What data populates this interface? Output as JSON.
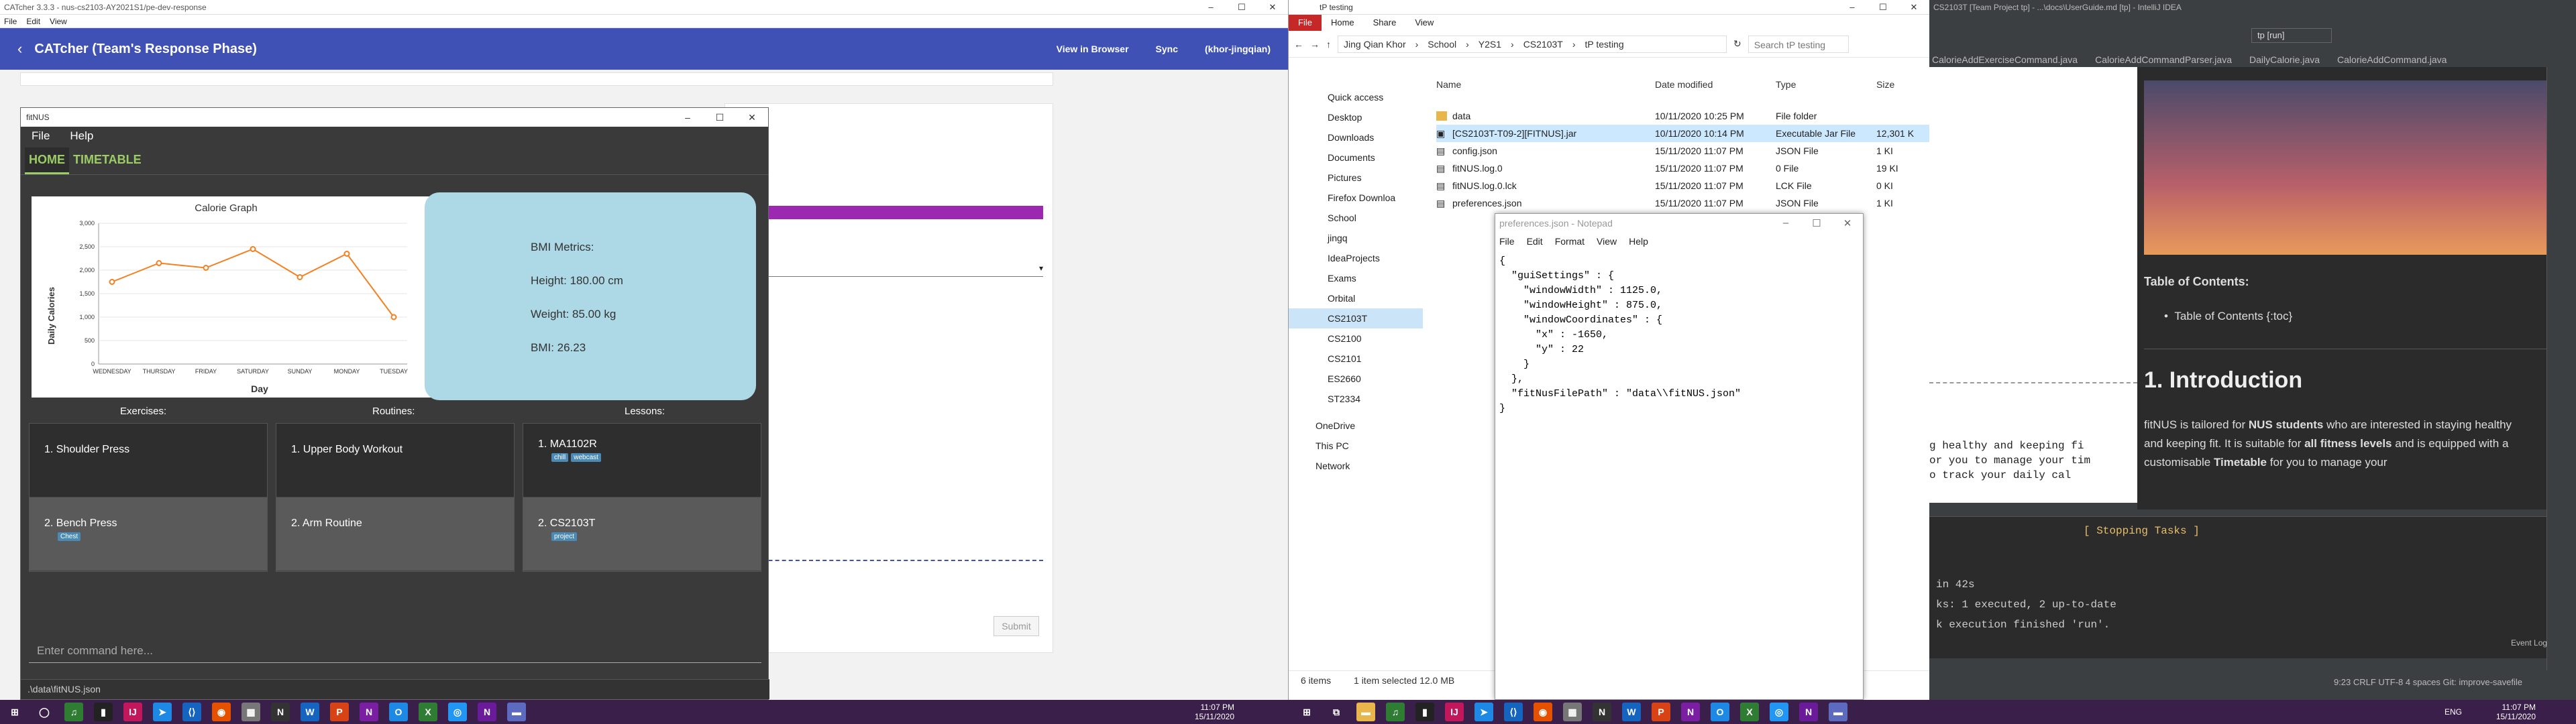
{
  "catcher": {
    "window_title": "CATcher 3.3.3 - nus-cs2103-AY2021S1/pe-dev-response",
    "menu": [
      "File",
      "Edit",
      "View"
    ],
    "header_title": "CATcher  (Team's Response Phase)",
    "view_in_browser": "View in Browser",
    "sync": "Sync",
    "user": "(khor-jingqian)",
    "submit": "Submit"
  },
  "fitnus": {
    "window_title": "fitNUS",
    "menu": [
      "File",
      "Help"
    ],
    "tabs": [
      "HOME",
      "TIMETABLE"
    ],
    "chart_data": {
      "type": "line",
      "title": "Calorie Graph",
      "xlabel": "Day",
      "ylabel": "Daily Calories",
      "categories": [
        "WEDNESDAY",
        "THURSDAY",
        "FRIDAY",
        "SATURDAY",
        "SUNDAY",
        "MONDAY",
        "TUESDAY"
      ],
      "values": [
        1750,
        2150,
        2050,
        2450,
        1850,
        2350,
        1000
      ],
      "yticks": [
        "3,000",
        "2,500",
        "2,000",
        "1,500",
        "1,000",
        "500",
        "0"
      ],
      "ylim": [
        0,
        3000
      ],
      "color": "#f4801f"
    },
    "bmi": {
      "header": "BMI Metrics:",
      "height": "Height: 180.00 cm",
      "weight": "Weight: 85.00 kg",
      "bmi": "BMI: 26.23"
    },
    "columns": {
      "exercises": "Exercises:",
      "routines": "Routines:",
      "lessons": "Lessons:"
    },
    "exercises": [
      {
        "label": "1.  Shoulder Press",
        "tags": []
      },
      {
        "label": "2.  Bench Press",
        "tags": [
          "Chest"
        ]
      }
    ],
    "routines": [
      {
        "label": "1.  Upper Body Workout"
      },
      {
        "label": "2.  Arm Routine"
      }
    ],
    "lessons": [
      {
        "label": "1.  MA1102R",
        "tags": [
          "chill",
          "webcast"
        ]
      },
      {
        "label": "2.  CS2103T",
        "tags": [
          "project"
        ]
      }
    ],
    "command_placeholder": "Enter command here...",
    "status": ".\\data\\fitNUS.json"
  },
  "explorer": {
    "title": "tP testing",
    "ribbon": [
      "File",
      "Home",
      "Share",
      "View"
    ],
    "breadcrumb": [
      "Jing Qian Khor",
      "School",
      "Y2S1",
      "CS2103T",
      "tP testing"
    ],
    "search_placeholder": "Search tP testing",
    "nav": [
      "Quick access",
      "Desktop",
      "Downloads",
      "Documents",
      "Pictures",
      "Firefox Downloa",
      "School",
      "jingq",
      "IdeaProjects",
      "Exams",
      "Orbital",
      "CS2103T",
      "CS2100",
      "CS2101",
      "ES2660",
      "ST2334",
      "OneDrive",
      "This PC",
      "Network"
    ],
    "col_headers": [
      "Name",
      "Date modified",
      "Type",
      "Size"
    ],
    "files": [
      {
        "name": "data",
        "date": "10/11/2020 10:25 PM",
        "type": "File folder",
        "size": ""
      },
      {
        "name": "[CS2103T-T09-2][FITNUS].jar",
        "date": "10/11/2020 10:14 PM",
        "type": "Executable Jar File",
        "size": "12,301 K"
      },
      {
        "name": "config.json",
        "date": "15/11/2020 11:07 PM",
        "type": "JSON File",
        "size": "1 KI"
      },
      {
        "name": "fitNUS.log.0",
        "date": "15/11/2020 11:07 PM",
        "type": "0 File",
        "size": "19 KI"
      },
      {
        "name": "fitNUS.log.0.lck",
        "date": "15/11/2020 11:07 PM",
        "type": "LCK File",
        "size": "0 KI"
      },
      {
        "name": "preferences.json",
        "date": "15/11/2020 11:07 PM",
        "type": "JSON File",
        "size": "1 KI"
      }
    ],
    "status_items": "6 items",
    "status_selected": "1 item selected  12.0 MB"
  },
  "notepad": {
    "title": "preferences.json - Notepad",
    "menu": [
      "File",
      "Edit",
      "Format",
      "View",
      "Help"
    ],
    "content": "{\n  \"guiSettings\" : {\n    \"windowWidth\" : 1125.0,\n    \"windowHeight\" : 875.0,\n    \"windowCoordinates\" : {\n      \"x\" : -1650,\n      \"y\" : 22\n    }\n  },\n  \"fitNusFilePath\" : \"data\\\\fitNUS.json\"\n}"
  },
  "ide": {
    "title": "CS2103T [Team Project tp] - ...\\docs\\UserGuide.md [tp] - IntelliJ IDEA",
    "run_config": "tp [run]",
    "tabs": [
      "CalorieAddExerciseCommand.java",
      "CalorieAddCommandParser.java",
      "DailyCalorie.java",
      "CalorieAddCommand.java"
    ],
    "toc_title": "Table of Contents:",
    "toc_item": "Table of Contents {:toc}",
    "intro_heading": "1. Introduction",
    "intro_p1": "fitNUS is tailored for ",
    "intro_b1": "NUS students",
    "intro_p2": " who are interested in staying healthy and keeping fit. It is suitable for ",
    "intro_b2": "all fitness levels",
    "intro_p3": " and is equipped with a customisable ",
    "intro_b3": "Timetable",
    "intro_p4": " for you to manage your",
    "editor_lines": [
      "g healthy and keeping fi",
      "or you to manage your tim",
      "o track your daily cal"
    ],
    "run_lines": [
      "[ Stopping Tasks ]",
      "in 42s",
      "ks: 1 executed, 2 up-to-date",
      "k execution finished 'run'."
    ],
    "event_log": "Event Log",
    "status": "9:23  CRLF  UTF-8  4 spaces  Git: improve-savefile"
  },
  "taskbar": {
    "left_time": "11:07 PM",
    "left_date": "15/11/2020",
    "right_time": "11:07 PM",
    "right_date": "15/11/2020",
    "lang": "ENG"
  }
}
